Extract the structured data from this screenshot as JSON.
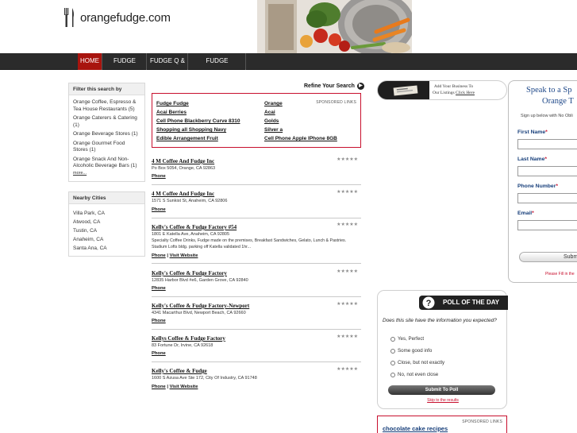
{
  "header": {
    "logo_text": "orangefudge.com"
  },
  "nav": {
    "items": [
      "HOME",
      "FUDGE NEWS",
      "FUDGE Q & A",
      "FUDGE PRODUCTS"
    ],
    "active": "HOME"
  },
  "filter": {
    "title": "Filter this search by",
    "items": [
      [
        "Orange Coffee, Espresso &",
        "Tea House Restaurants (5)"
      ],
      [
        "Orange Caterers & Catering",
        "(1)"
      ],
      [
        "Orange Beverage Stores (1)"
      ],
      [
        "Orange Gourmet Food",
        "Stores (1)"
      ],
      [
        "Orange Snack And Non-",
        "Alcoholic Beverage Bars (1)"
      ]
    ],
    "more": "more..."
  },
  "nearby": {
    "title": "Nearby Cities",
    "cities": [
      "Villa Park, CA",
      "Atwood, CA",
      "Tustin, CA",
      "Anaheim, CA",
      "Santa Ana, CA"
    ]
  },
  "refine": {
    "label": "Refine Your Search"
  },
  "sponsored": {
    "tag": "SPONSORED LINKS",
    "left": [
      "Fudge Fudge",
      "Acai Berries",
      "Cell Phone Blackberry Curve 8310",
      "Shopping all Shopping Navy",
      "Edible Arrangement Fruit"
    ],
    "right": [
      "Orange",
      "Acai",
      "Golds",
      "Silver a",
      "Cell Phone Apple IPhone 8GB"
    ]
  },
  "listings": [
    {
      "name": "4 M Coffee And Fudge Inc",
      "address": "Po Box 5054, Orange, CA 92863",
      "desc": "",
      "links": [
        "Phone"
      ],
      "rating": 5
    },
    {
      "name": "4 M Coffee And Fudge Inc",
      "address": "1571 S Sunkist St, Anaheim, CA 92806",
      "desc": "",
      "links": [
        "Phone"
      ],
      "rating": 5
    },
    {
      "name": "Kelly's Coffee & Fudge Factory #54",
      "address": "1801 E Katella Ave, Anaheim, CA 92805",
      "desc": "Specialty Coffee Drinks, Fudge made on the premises, Breakfast Sandwiches, Gelato, Lunch & Pastries. Stadium Lofts bldg. parking off Katella validated 1hr...",
      "links": [
        "Phone",
        "Visit Website"
      ],
      "rating": 5
    },
    {
      "name": "Kelly's Coffee & Fudge Factory",
      "address": "12835 Harbor Blvd #e6, Garden Grove, CA 92840",
      "desc": "",
      "links": [
        "Phone"
      ],
      "rating": 5
    },
    {
      "name": "Kelly's Coffee & Fudge Factory-Newport",
      "address": "4341 Macarthur Blvd, Newport Beach, CA 92660",
      "desc": "",
      "links": [
        "Phone"
      ],
      "rating": 5
    },
    {
      "name": "Kellys Coffee & Fudge Factory",
      "address": "83 Fortune Dr, Irvine, CA 92618",
      "desc": "",
      "links": [
        "Phone"
      ],
      "rating": 5
    },
    {
      "name": "Kelly's Coffee & Fudge",
      "address": "1600 S Azusa Ave Ste 172, City Of Industry, CA 91748",
      "desc": "",
      "links": [
        "Phone",
        "Visit Website"
      ],
      "rating": 5
    }
  ],
  "ad": {
    "line1": "Add Your Business To",
    "line2_prefix": "Our Listings ",
    "line2_link": "Click Here"
  },
  "poll": {
    "title": "POLL OF THE DAY",
    "question": "Does this site have the information you expected?",
    "options": [
      "Yes, Perfect",
      "Some good info",
      "Close, but not exactly",
      "No, not even close"
    ],
    "submit": "Submit To Poll",
    "skip": "Skip to the results"
  },
  "sponsored2": {
    "tag": "SPONSORED LINKS",
    "link": "chocolate cake recipes"
  },
  "form": {
    "heading1": "Speak to a Sp",
    "heading2": "Orange T",
    "signup": "Sign up below with No Obli",
    "fields": [
      "First Name",
      "Last Name",
      "Phone Number",
      "Email"
    ],
    "required_mark": "*",
    "submit": "Submi",
    "note": "Please Fill in the"
  }
}
